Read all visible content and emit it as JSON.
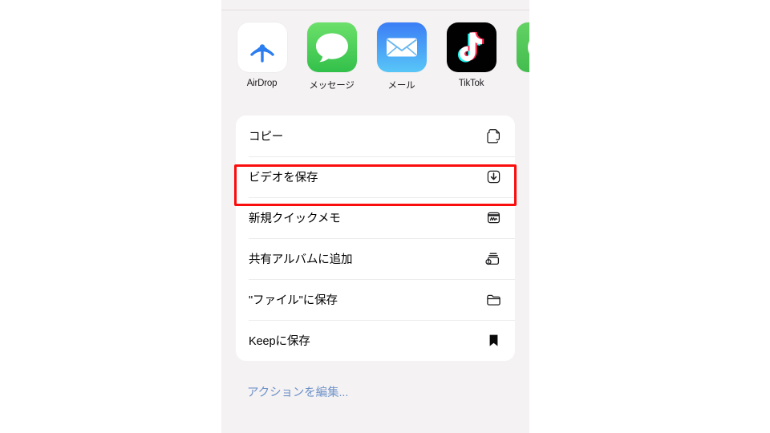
{
  "share_sheet": {
    "apps": [
      {
        "label": "AirDrop",
        "icon": "airdrop-icon"
      },
      {
        "label": "メッセージ",
        "icon": "messages-icon"
      },
      {
        "label": "メール",
        "icon": "mail-icon"
      },
      {
        "label": "TikTok",
        "icon": "tiktok-icon"
      },
      {
        "label": "",
        "icon": "green-app-icon-partial"
      }
    ],
    "actions": [
      {
        "label": "コピー",
        "icon": "copy-icon"
      },
      {
        "label": "ビデオを保存",
        "icon": "save-download-icon"
      },
      {
        "label": "新規クイックメモ",
        "icon": "quick-note-icon"
      },
      {
        "label": "共有アルバムに追加",
        "icon": "shared-album-icon"
      },
      {
        "label": "\"ファイル\"に保存",
        "icon": "folder-icon"
      },
      {
        "label": "Keepに保存",
        "icon": "bookmark-icon"
      }
    ],
    "edit_actions_label": "アクションを編集...",
    "highlight": {
      "target_label": "ビデオを保存",
      "color": "#fb0d0d"
    },
    "colors": {
      "panel_background": "#f5f2f3",
      "card_background": "#ffffff",
      "link": "#6f93c9",
      "text": "#000000"
    }
  }
}
